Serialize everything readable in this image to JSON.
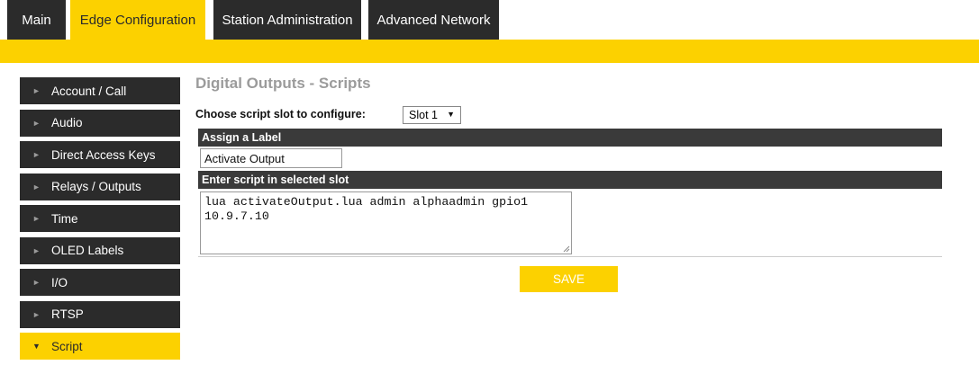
{
  "tabs": [
    {
      "label": "Main"
    },
    {
      "label": "Edge Configuration"
    },
    {
      "label": "Station Administration"
    },
    {
      "label": "Advanced Network"
    }
  ],
  "active_tab": "Edge Configuration",
  "sidebar": {
    "items": [
      {
        "label": "Account / Call"
      },
      {
        "label": "Audio"
      },
      {
        "label": "Direct Access Keys"
      },
      {
        "label": "Relays / Outputs"
      },
      {
        "label": "Time"
      },
      {
        "label": "OLED Labels"
      },
      {
        "label": "I/O"
      },
      {
        "label": "RTSP"
      },
      {
        "label": "Script"
      }
    ],
    "active_item": "Script"
  },
  "main": {
    "title": "Digital Outputs - Scripts",
    "slot_prompt": "Choose script slot to configure:",
    "slot_value": "Slot 1",
    "label_section": "Assign a Label",
    "label_value": "Activate Output",
    "script_section": "Enter script in selected slot",
    "script_value": "lua activateOutput.lua admin alphaadmin gpio1\n10.9.7.10",
    "save_label": "SAVE"
  },
  "colors": {
    "accent": "#fcd100",
    "dark": "#2b2b2b",
    "section": "#3a3a3a",
    "title_gray": "#9b9b9b"
  }
}
